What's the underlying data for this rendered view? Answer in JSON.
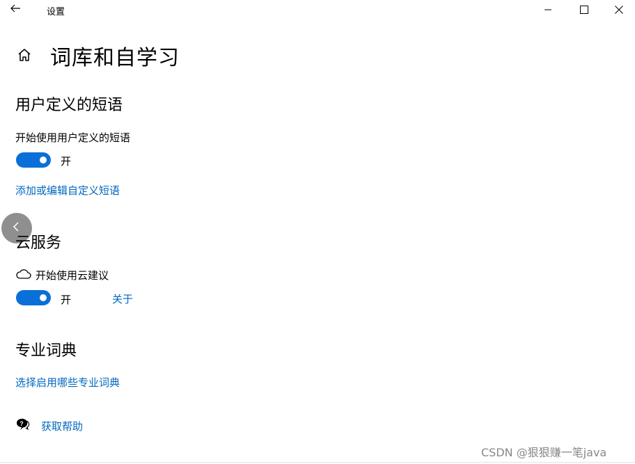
{
  "window": {
    "title": "设置"
  },
  "page": {
    "title": "词库和自学习"
  },
  "user_phrases": {
    "section_title": "用户定义的短语",
    "toggle_label": "开始使用用户定义的短语",
    "toggle_state": "开",
    "toggle_on": true,
    "link": "添加或编辑自定义短语"
  },
  "cloud": {
    "section_title": "云服务",
    "toggle_label": "开始使用云建议",
    "toggle_state": "开",
    "toggle_on": true,
    "about_link": "关于"
  },
  "dictionaries": {
    "section_title": "专业词典",
    "link": "选择启用哪些专业词典"
  },
  "help": {
    "link": "获取帮助"
  },
  "watermark": "CSDN @狠狠赚一笔java",
  "icons": {
    "back": "back-arrow-icon",
    "home": "home-icon",
    "minimize": "minimize-icon",
    "maximize": "maximize-icon",
    "close": "close-icon",
    "cloud": "cloud-icon",
    "help": "help-chat-icon",
    "float_back": "chevron-left-icon"
  },
  "colors": {
    "accent": "#0a6fd8",
    "link": "#0067c0"
  }
}
